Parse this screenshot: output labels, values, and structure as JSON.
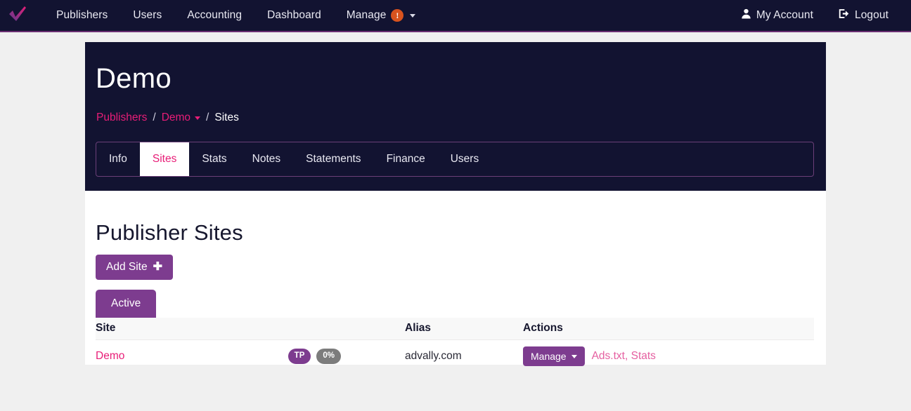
{
  "navbar": {
    "logo_icon": "advally-checkmark-logo",
    "left_items": [
      {
        "label": "Publishers"
      },
      {
        "label": "Users"
      },
      {
        "label": "Accounting"
      },
      {
        "label": "Dashboard"
      },
      {
        "label": "Manage",
        "badge": "!",
        "badge_color": "#d9531e",
        "has_caret": true
      }
    ],
    "right_items": [
      {
        "label": "My Account",
        "icon": "user-icon"
      },
      {
        "label": "Logout",
        "icon": "logout-icon"
      }
    ]
  },
  "panel": {
    "title": "Demo",
    "breadcrumb": [
      {
        "label": "Publishers",
        "type": "link"
      },
      {
        "label": "/",
        "type": "separator"
      },
      {
        "label": "Demo",
        "type": "link-dropdown"
      },
      {
        "label": "/",
        "type": "separator"
      },
      {
        "label": "Sites",
        "type": "current"
      }
    ],
    "tabs": [
      {
        "label": "Info",
        "active": false
      },
      {
        "label": "Sites",
        "active": true
      },
      {
        "label": "Stats",
        "active": false
      },
      {
        "label": "Notes",
        "active": false
      },
      {
        "label": "Statements",
        "active": false
      },
      {
        "label": "Finance",
        "active": false
      },
      {
        "label": "Users",
        "active": false
      }
    ]
  },
  "main": {
    "heading": "Publisher Sites",
    "add_site_label": "Add Site",
    "add_site_icon": "plus-icon",
    "status_tabs": [
      {
        "label": "Active",
        "active": true
      }
    ],
    "table": {
      "columns": [
        "Site",
        "Alias",
        "Actions"
      ],
      "rows": [
        {
          "site": "Demo",
          "badges": [
            {
              "label": "TP",
              "color": "#7d3c8f"
            },
            {
              "label": "0%",
              "color": "#7c7c7c"
            }
          ],
          "alias": "advally.com",
          "manage_label": "Manage",
          "action_links": [
            "Ads.txt",
            "Stats"
          ],
          "action_separator": ","
        }
      ]
    }
  },
  "colors": {
    "navbar_bg": "#121331",
    "panel_bg": "#121331",
    "page_bg": "#f0f0f0",
    "accent_pink": "#e81d77",
    "accent_purple": "#7d3c8f",
    "card_bg": "#ffffff"
  }
}
